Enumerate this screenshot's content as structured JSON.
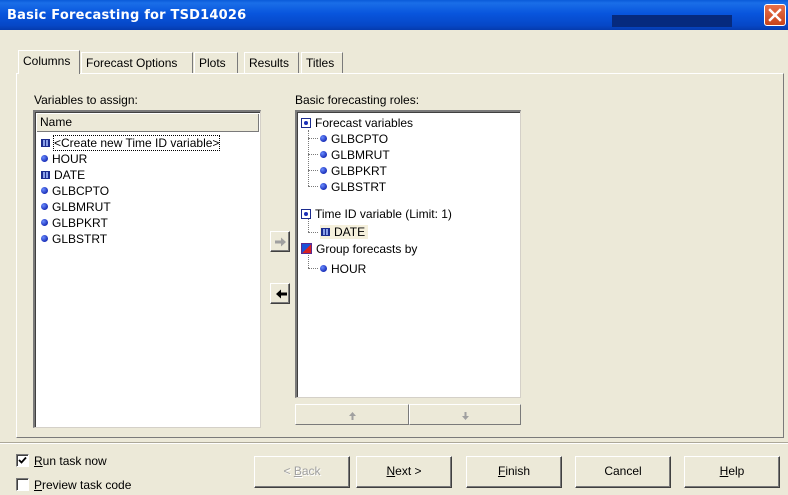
{
  "window": {
    "title": "Basic Forecasting for TSD14026",
    "close_icon": "close-icon"
  },
  "tabs": [
    {
      "label": "Columns",
      "active": true
    },
    {
      "label": "Forecast Options",
      "active": false
    },
    {
      "label": "Plots",
      "active": false
    },
    {
      "label": "Results",
      "active": false
    },
    {
      "label": "Titles",
      "active": false
    }
  ],
  "variables_panel": {
    "label": "Variables to assign:",
    "column_header": "Name",
    "items": [
      {
        "label": "<Create new Time ID variable>",
        "icon": "date-grid-icon"
      },
      {
        "label": "HOUR",
        "icon": "numeric-dot-icon"
      },
      {
        "label": "DATE",
        "icon": "date-grid-icon"
      },
      {
        "label": "GLBCPTO",
        "icon": "numeric-dot-icon"
      },
      {
        "label": "GLBMRUT",
        "icon": "numeric-dot-icon"
      },
      {
        "label": "GLBPKRT",
        "icon": "numeric-dot-icon"
      },
      {
        "label": "GLBSTRT",
        "icon": "numeric-dot-icon"
      }
    ]
  },
  "roles_panel": {
    "label": "Basic forecasting roles:",
    "forecast_variables": {
      "label": "Forecast variables",
      "children": [
        "GLBCPTO",
        "GLBMRUT",
        "GLBPKRT",
        "GLBSTRT"
      ]
    },
    "time_id": {
      "label": "Time ID variable  (Limit: 1)",
      "children": [
        "DATE"
      ]
    },
    "group_by": {
      "label": "Group forecasts by",
      "children": [
        "HOUR"
      ]
    }
  },
  "options": {
    "run_task_now": {
      "label_underlined": "R",
      "label_rest": "un task now",
      "checked": true
    },
    "preview_task_code": {
      "label_underlined": "P",
      "label_rest": "review task code",
      "checked": false
    }
  },
  "buttons": {
    "back": {
      "prefix": "< ",
      "underlined": "B",
      "rest": "ack",
      "enabled": false
    },
    "next": {
      "underlined": "N",
      "rest": "ext >",
      "enabled": true
    },
    "finish": {
      "underlined": "F",
      "rest": "inish",
      "enabled": true
    },
    "cancel": {
      "label": "Cancel",
      "enabled": true
    },
    "help": {
      "underlined": "H",
      "rest": "elp",
      "enabled": true
    }
  }
}
